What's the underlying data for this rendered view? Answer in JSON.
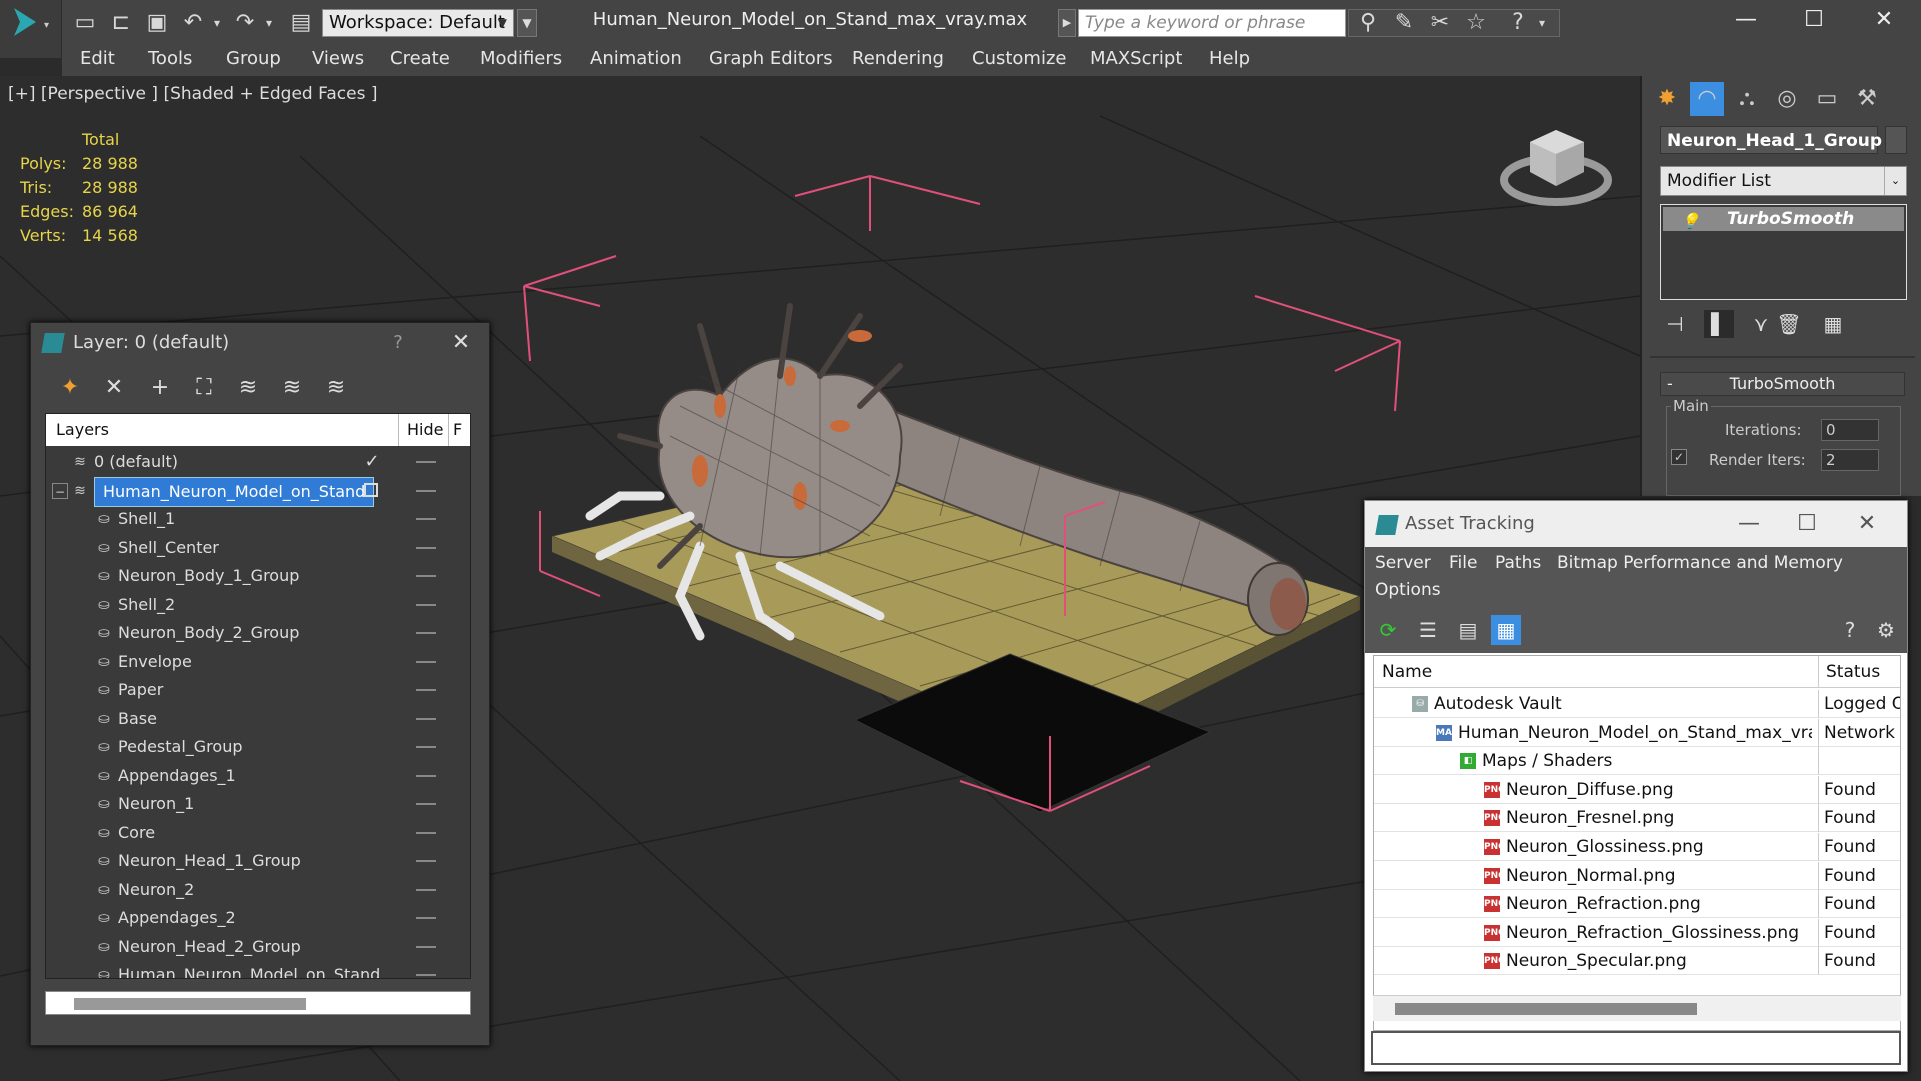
{
  "titlebar": {
    "workspace_label": "Workspace: Default",
    "file_title": "Human_Neuron_Model_on_Stand_max_vray.max",
    "search_placeholder": "Type a keyword or phrase"
  },
  "menu": [
    "Edit",
    "Tools",
    "Group",
    "Views",
    "Create",
    "Modifiers",
    "Animation",
    "Graph Editors",
    "Rendering",
    "Customize",
    "MAXScript",
    "Help"
  ],
  "viewport": {
    "label": "[+] [Perspective ] [Shaded + Edged Faces ]",
    "stats": {
      "header": "Total",
      "rows": [
        {
          "k": "Polys:",
          "v": "28 988"
        },
        {
          "k": "Tris:",
          "v": "28 988"
        },
        {
          "k": "Edges:",
          "v": "86 964"
        },
        {
          "k": "Verts:",
          "v": "14 568"
        }
      ]
    }
  },
  "command_panel": {
    "object_name": "Neuron_Head_1_Group",
    "modifier_list": "Modifier List",
    "stack_item": "TurboSmooth",
    "rollout_title": "TurboSmooth",
    "group_label": "Main",
    "iterations_label": "Iterations:",
    "iterations_value": "0",
    "render_iters_label": "Render Iters:",
    "render_iters_value": "2"
  },
  "layer_window": {
    "title": "Layer: 0 (default)",
    "help": "?",
    "col_layers": "Layers",
    "col_hide": "Hide",
    "col_f": "F",
    "rows": [
      {
        "name": "0 (default)",
        "level": 1
      },
      {
        "name": "Human_Neuron_Model_on_Stand",
        "level": 1,
        "selected": true
      },
      {
        "name": "Shell_1",
        "level": 2
      },
      {
        "name": "Shell_Center",
        "level": 2
      },
      {
        "name": "Neuron_Body_1_Group",
        "level": 2
      },
      {
        "name": "Shell_2",
        "level": 2
      },
      {
        "name": "Neuron_Body_2_Group",
        "level": 2
      },
      {
        "name": "Envelope",
        "level": 2
      },
      {
        "name": "Paper",
        "level": 2
      },
      {
        "name": "Base",
        "level": 2
      },
      {
        "name": "Pedestal_Group",
        "level": 2
      },
      {
        "name": "Appendages_1",
        "level": 2
      },
      {
        "name": "Neuron_1",
        "level": 2
      },
      {
        "name": "Core",
        "level": 2
      },
      {
        "name": "Neuron_Head_1_Group",
        "level": 2
      },
      {
        "name": "Neuron_2",
        "level": 2
      },
      {
        "name": "Appendages_2",
        "level": 2
      },
      {
        "name": "Neuron_Head_2_Group",
        "level": 2
      },
      {
        "name": "Human_Neuron_Model_on_Stand",
        "level": 2
      }
    ]
  },
  "asset_tracking": {
    "title": "Asset Tracking",
    "menu": [
      "Server",
      "File",
      "Paths",
      "Bitmap Performance and Memory",
      "Options"
    ],
    "col_name": "Name",
    "col_status": "Status",
    "rows": [
      {
        "name": "Autodesk Vault",
        "status": "Logged O",
        "level": 1,
        "icon": "vault-icon"
      },
      {
        "name": "Human_Neuron_Model_on_Stand_max_vra...",
        "status": "Network F",
        "level": 2,
        "icon": "max-file-icon"
      },
      {
        "name": "Maps / Shaders",
        "status": "",
        "level": 3,
        "icon": "maps-icon"
      },
      {
        "name": "Neuron_Diffuse.png",
        "status": "Found",
        "level": 4,
        "icon": "png-icon"
      },
      {
        "name": "Neuron_Fresnel.png",
        "status": "Found",
        "level": 4,
        "icon": "png-icon"
      },
      {
        "name": "Neuron_Glossiness.png",
        "status": "Found",
        "level": 4,
        "icon": "png-icon"
      },
      {
        "name": "Neuron_Normal.png",
        "status": "Found",
        "level": 4,
        "icon": "png-icon"
      },
      {
        "name": "Neuron_Refraction.png",
        "status": "Found",
        "level": 4,
        "icon": "png-icon"
      },
      {
        "name": "Neuron_Refraction_Glossiness.png",
        "status": "Found",
        "level": 4,
        "icon": "png-icon"
      },
      {
        "name": "Neuron_Specular.png",
        "status": "Found",
        "level": 4,
        "icon": "png-icon"
      }
    ]
  },
  "colors": {
    "stats_text": "#e6d44a",
    "selection": "#2f7bd6",
    "png_badge": "#c83232",
    "bounding_box": "#e0507a",
    "stand_top": "#a89a58"
  }
}
